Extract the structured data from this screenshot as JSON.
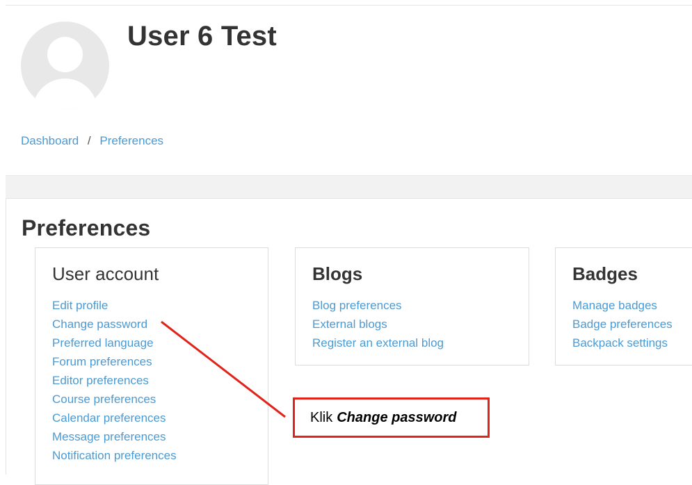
{
  "profile": {
    "name": "User 6 Test",
    "avatar_icon": "user-avatar-icon"
  },
  "breadcrumb": {
    "items": [
      "Dashboard",
      "Preferences"
    ],
    "separator": "/"
  },
  "page": {
    "title": "Preferences"
  },
  "sections": {
    "user_account": {
      "title": "User account",
      "links": [
        "Edit profile",
        "Change password",
        "Preferred language",
        "Forum preferences",
        "Editor preferences",
        "Course preferences",
        "Calendar preferences",
        "Message preferences",
        "Notification preferences"
      ]
    },
    "blogs": {
      "title": "Blogs",
      "links": [
        "Blog preferences",
        "External blogs",
        "Register an external blog"
      ]
    },
    "badges": {
      "title": "Badges",
      "links": [
        "Manage badges",
        "Badge preferences",
        "Backpack settings"
      ]
    }
  },
  "annotation": {
    "prefix": "Klik",
    "emphasis": "Change password",
    "color": "#e2231a"
  },
  "colors": {
    "link": "#4a9ad4",
    "heading": "#333333"
  }
}
